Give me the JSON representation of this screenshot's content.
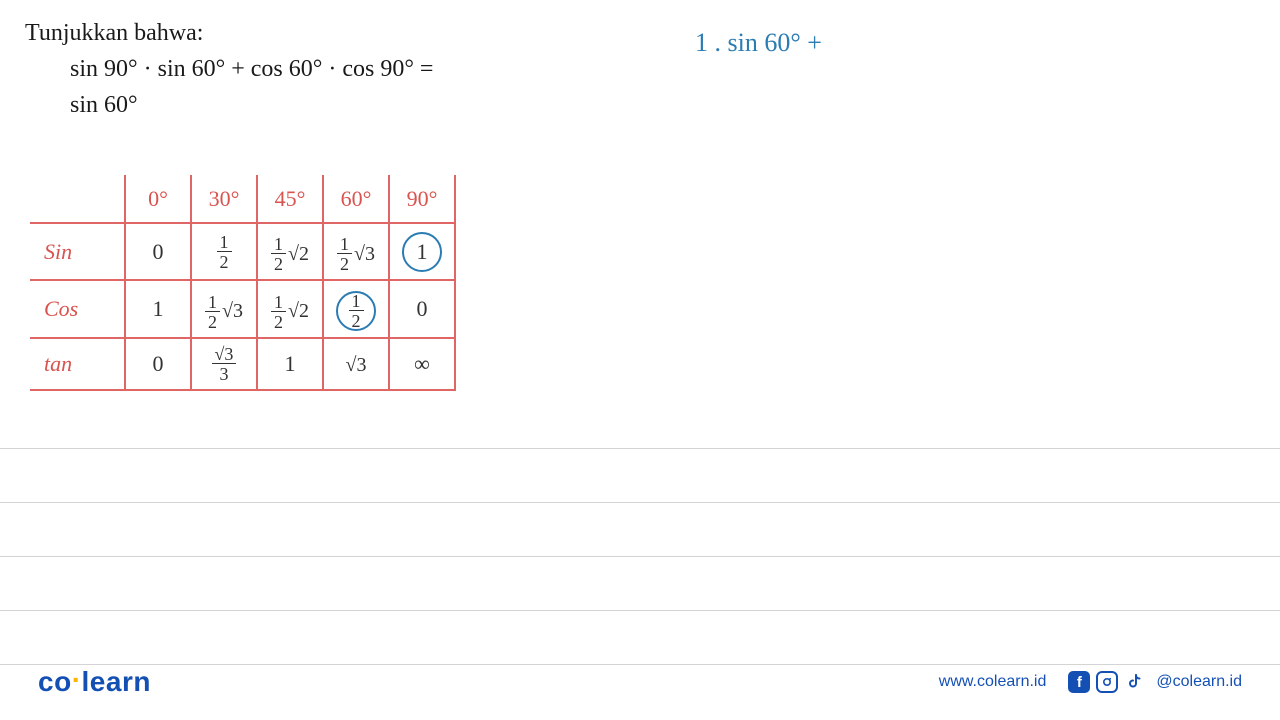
{
  "problem": {
    "title": "Tunjukkan bahwa:",
    "line1": "sin 90° · sin 60° + cos 60° · cos 90° =",
    "line2": "sin 60°"
  },
  "handwritten": {
    "step1": "1 . sin 60° +"
  },
  "trig_table": {
    "headers": [
      "",
      "0°",
      "30°",
      "45°",
      "60°",
      "90°"
    ],
    "rows": [
      {
        "label": "Sin",
        "cells": [
          "0",
          "1/2",
          "1/2 √2",
          "1/2 √3",
          "1"
        ],
        "circled": [
          false,
          false,
          false,
          false,
          true
        ]
      },
      {
        "label": "Cos",
        "cells": [
          "1",
          "1/2 √3",
          "1/2 √2",
          "1/2",
          "0"
        ],
        "circled": [
          false,
          false,
          false,
          true,
          false
        ]
      },
      {
        "label": "tan",
        "cells": [
          "0",
          "√3/3",
          "1",
          "√3",
          "∞"
        ],
        "circled": [
          false,
          false,
          false,
          false,
          false
        ]
      }
    ]
  },
  "footer": {
    "logo_left": "co",
    "logo_right": "learn",
    "url": "www.colearn.id",
    "handle": "@colearn.id"
  }
}
